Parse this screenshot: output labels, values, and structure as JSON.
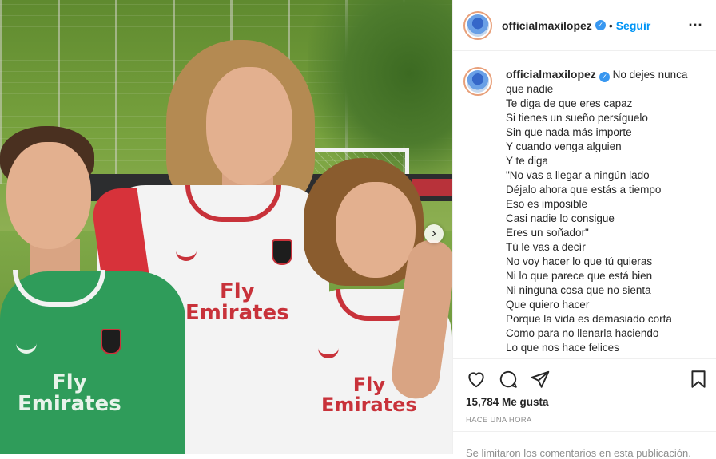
{
  "post": {
    "photo": {
      "sponsor_line1": "Fly",
      "sponsor_line2": "Emirates",
      "next_icon": "chevron-right-icon"
    },
    "header": {
      "username": "officialmaxilopez",
      "verified_icon": "verified-badge-icon",
      "separator": "•",
      "follow_label": "Seguir",
      "more_icon": "⋯"
    },
    "caption": {
      "username": "officialmaxilopez",
      "lines": [
        "No dejes nunca",
        "que nadie",
        "Te diga de que eres capaz",
        "Si tienes un sueño persíguelo",
        "Sin que nada más importe",
        "Y cuando venga alguien",
        "Y te diga",
        "\"No vas a llegar a ningún lado",
        "Déjalo ahora que estás a tiempo",
        "Eso es imposible",
        "Casi nadie lo consigue",
        "Eres un soñador\"",
        "Tú le vas a decír",
        "No voy hacer lo que tú quieras",
        "Ni lo que parece que está bien",
        "Ni ninguna cosa que no sienta",
        "Que quiero hacer",
        "Porque la vida es demasiado corta",
        "Como para no llenarla haciendo",
        "Lo que nos hace felices"
      ]
    },
    "actions": {
      "like_icon": "heart-icon",
      "comment_icon": "comment-icon",
      "share_icon": "paper-plane-icon",
      "save_icon": "bookmark-icon"
    },
    "likes": "15,784 Me gusta",
    "timestamp": "HACE UNA HORA",
    "comments_notice": "Se limitaron los comentarios en esta publicación."
  },
  "colors": {
    "accent": "#0095f6",
    "verified": "#3897f0",
    "muted": "#8e8e8e",
    "milan_red": "#c8323a"
  }
}
